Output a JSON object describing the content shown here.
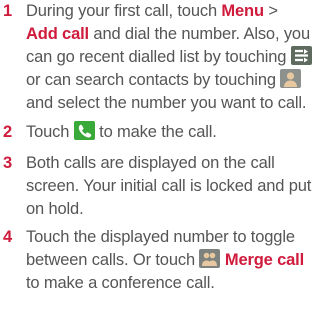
{
  "colors": {
    "accent": "#cf1b3c",
    "text": "#555555",
    "call_green": "#39a939"
  },
  "icons": [
    "recent-dialled-icon",
    "contact-icon",
    "call-icon",
    "merge-call-icon"
  ],
  "steps": [
    {
      "number": "1",
      "lines": {
        "l1_a": "During your first call, touch ",
        "l1_menu": "Menu",
        "l1_b": " >",
        "l2_add": "Add call",
        "l2_b": " and dial the number. Also, you",
        "l3": "can go recent dialled list by touching ",
        "l4": "or can search contacts by touching ",
        "l5": "and select the number you want to call."
      }
    },
    {
      "number": "2",
      "lines": {
        "l1_a": "Touch ",
        "l1_b": " to make the call."
      }
    },
    {
      "number": "3",
      "lines": {
        "l1": "Both calls are displayed on the call",
        "l2": "screen. Your initial call is locked and put",
        "l3": "on hold."
      }
    },
    {
      "number": "4",
      "lines": {
        "l1": "Touch the displayed number to toggle",
        "l2_a": "between calls. Or touch ",
        "l2_merge": "Merge call",
        "l3": "to make a conference call."
      }
    }
  ]
}
